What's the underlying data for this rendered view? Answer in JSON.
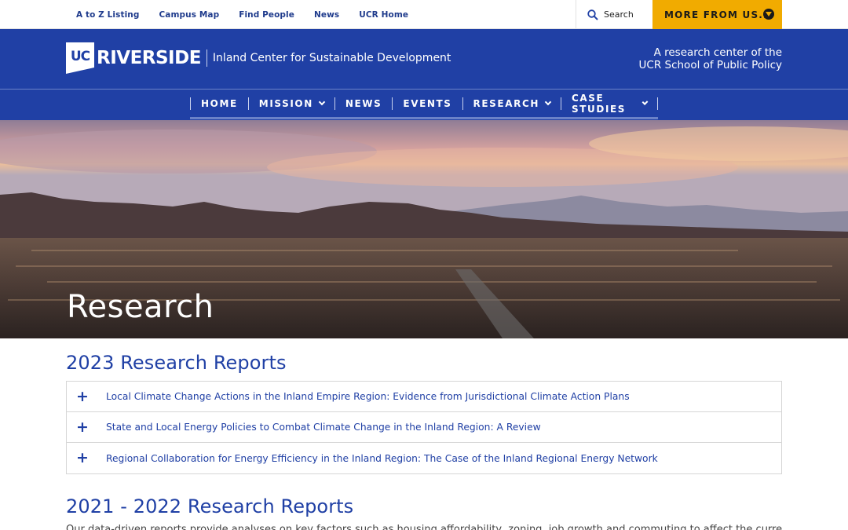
{
  "utility_bar": {
    "links": [
      "A to Z Listing",
      "Campus Map",
      "Find People",
      "News",
      "UCR Home"
    ],
    "search_label": "Search",
    "more_label": "MORE FROM US..."
  },
  "header": {
    "logo_uc": "UC",
    "logo_riverside": "RIVERSIDE",
    "center_name": "Inland Center for Sustainable Development",
    "tagline_line1": "A research center of the",
    "tagline_line2": "UCR School of Public Policy"
  },
  "nav": {
    "items": [
      {
        "label": "HOME",
        "dropdown": false
      },
      {
        "label": "MISSION",
        "dropdown": true
      },
      {
        "label": "NEWS",
        "dropdown": false
      },
      {
        "label": "EVENTS",
        "dropdown": false
      },
      {
        "label": "RESEARCH",
        "dropdown": true
      },
      {
        "label": "CASE STUDIES",
        "dropdown": true
      }
    ]
  },
  "hero": {
    "title": "Research"
  },
  "sections": [
    {
      "title": "2023 Research Reports",
      "reports": [
        "Local Climate Change Actions in the Inland Empire Region: Evidence from Jurisdictional Climate Action Plans",
        "State and Local Energy Policies to Combat Climate Change in the Inland Region: A Review",
        "Regional Collaboration for Energy Efficiency in the Inland Region: The Case of the Inland Regional Energy Network"
      ]
    },
    {
      "title": "2021 - 2022 Research Reports",
      "intro": "Our data-driven reports provide analyses on key factors such as housing affordability, zoning, job growth and commuting to affect the current state of housing"
    }
  ],
  "colors": {
    "brand_blue": "#2040a5",
    "gold": "#f1ab00"
  }
}
